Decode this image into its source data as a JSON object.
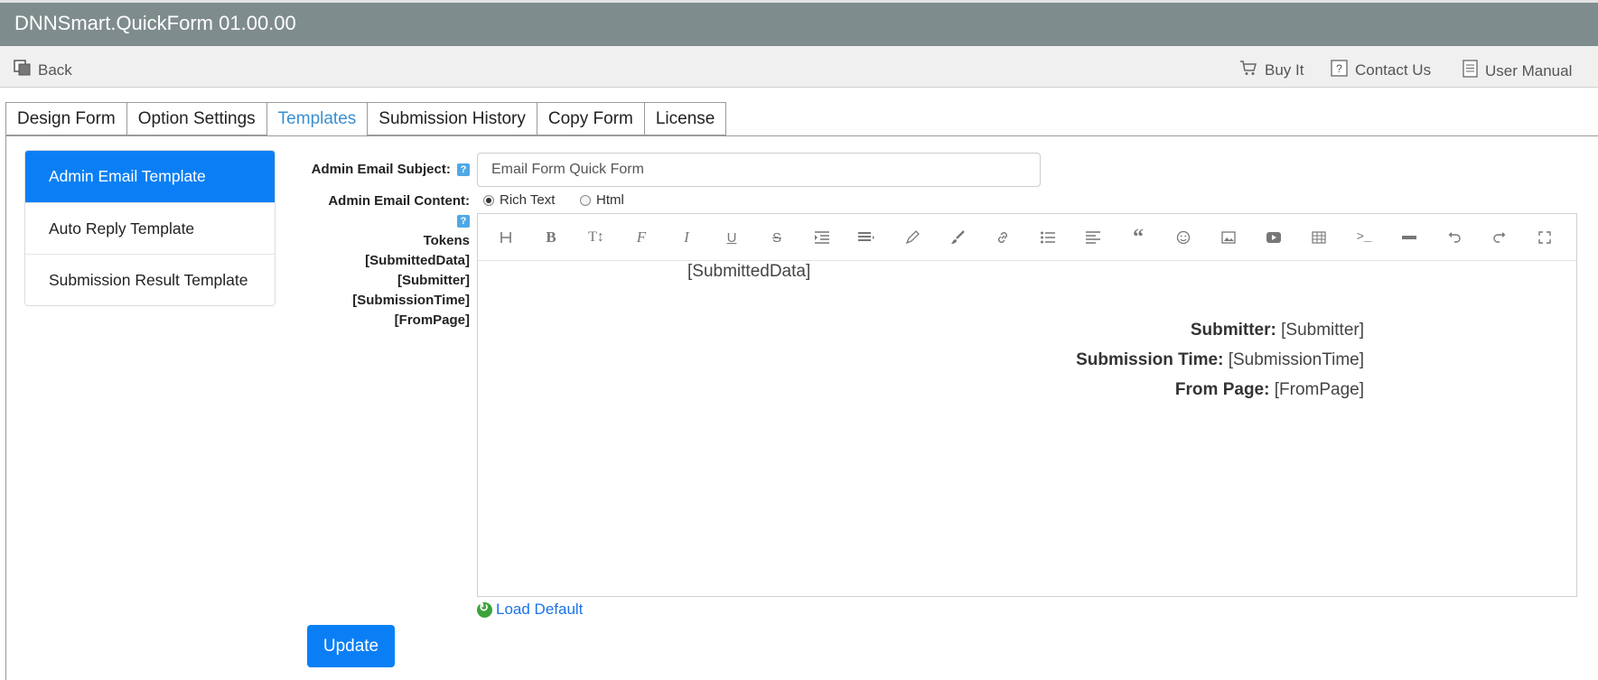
{
  "app": {
    "title": "DNNSmart.QuickForm 01.00.00"
  },
  "toolbar": {
    "back": "Back",
    "buy": "Buy It",
    "contact": "Contact Us",
    "manual": "User Manual"
  },
  "tabs": [
    "Design Form",
    "Option Settings",
    "Templates",
    "Submission History",
    "Copy Form",
    "License"
  ],
  "active_tab": "Templates",
  "sidebar": [
    "Admin Email Template",
    "Auto Reply Template",
    "Submission Result Template"
  ],
  "form": {
    "subject_label": "Admin Email Subject:",
    "subject_value": "Email Form Quick Form",
    "content_label": "Admin Email Content:",
    "radio_rich": "Rich Text",
    "radio_html": "Html",
    "selected_format": "Rich Text",
    "tokens_title": "Tokens",
    "tokens": [
      "[SubmittedData]",
      "[Submitter]",
      "[SubmissionTime]",
      "[FromPage]"
    ]
  },
  "editor": {
    "toolbar_icons": [
      "heading-icon",
      "bold-icon",
      "text-height-icon",
      "font-icon",
      "italic-icon",
      "underline-icon",
      "strikethrough-icon",
      "indent-icon",
      "align-icon",
      "pencil-icon",
      "brush-icon",
      "link-icon",
      "list-icon",
      "paragraph-icon",
      "quote-icon",
      "emoji-icon",
      "image-icon",
      "video-icon",
      "table-icon",
      "code-icon",
      "hr-icon",
      "undo-icon",
      "redo-icon",
      "fullscreen-icon"
    ],
    "content": {
      "submitted_data": "[SubmittedData]",
      "submitter_label": "Submitter:",
      "submitter_value": "[Submitter]",
      "time_label": "Submission Time:",
      "time_value": "[SubmissionTime]",
      "page_label": "From Page:",
      "page_value": "[FromPage]"
    }
  },
  "actions": {
    "load_default": "Load Default",
    "update": "Update"
  },
  "colors": {
    "header": "#7f8c8d",
    "primary": "#0a7ff5",
    "tab_active": "#3a8fd1"
  }
}
